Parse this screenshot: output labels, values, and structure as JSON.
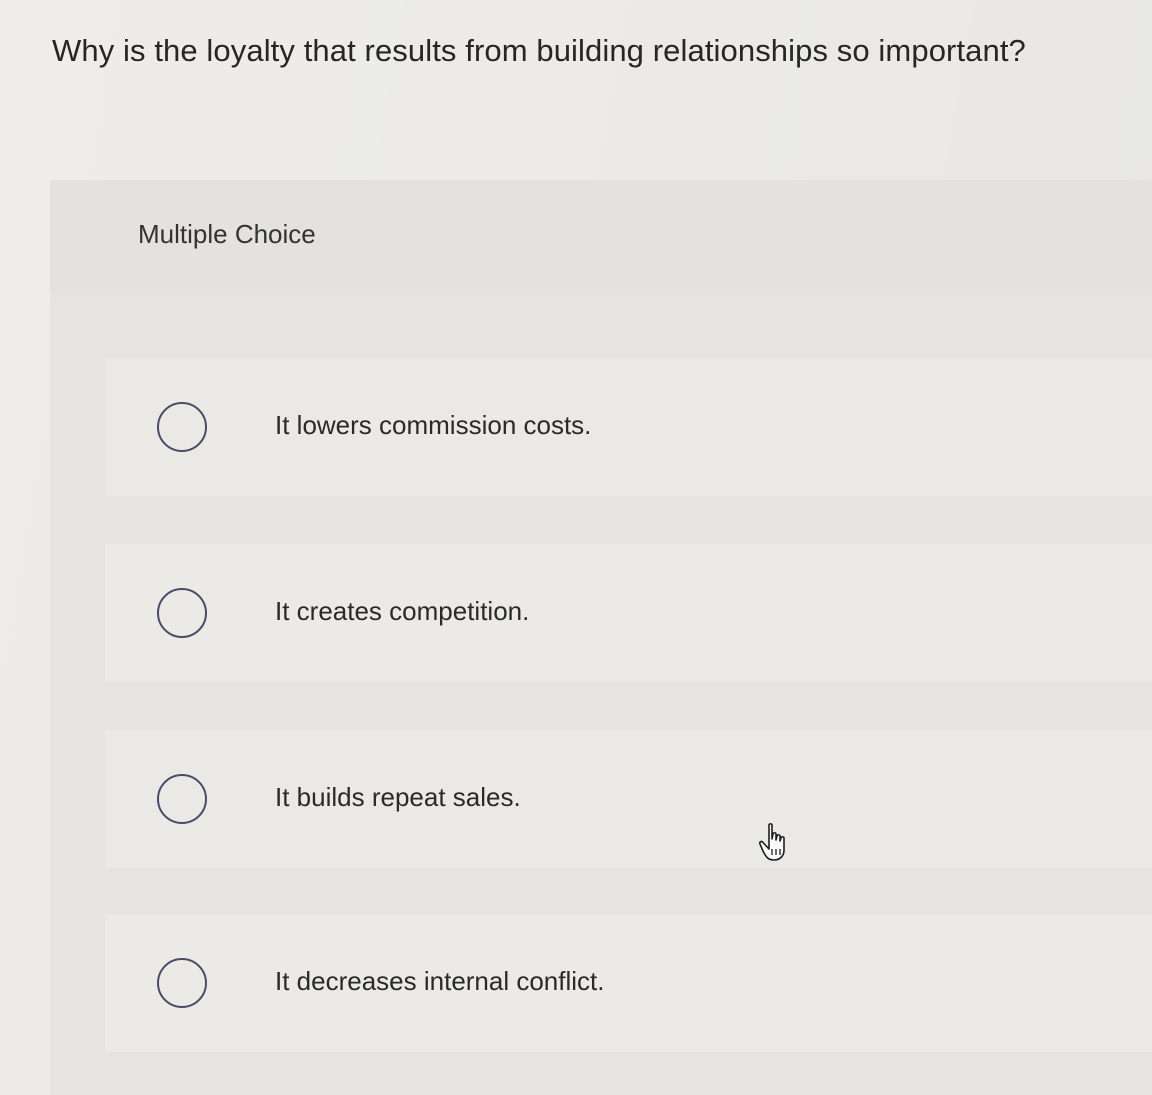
{
  "question": {
    "text": "Why is the loyalty that results from building relationships so important?"
  },
  "multiple_choice": {
    "label": "Multiple Choice",
    "options": [
      {
        "label": "It lowers commission costs.",
        "selected": false
      },
      {
        "label": "It creates competition.",
        "selected": false
      },
      {
        "label": "It builds repeat sales.",
        "selected": false
      },
      {
        "label": "It decreases internal conflict.",
        "selected": false
      }
    ]
  },
  "icons": {
    "radio": "radio-unselected-icon",
    "cursor": "hand-pointer-icon"
  },
  "colors": {
    "radio_border": "#4a4b68",
    "background": "#ecebe7"
  }
}
